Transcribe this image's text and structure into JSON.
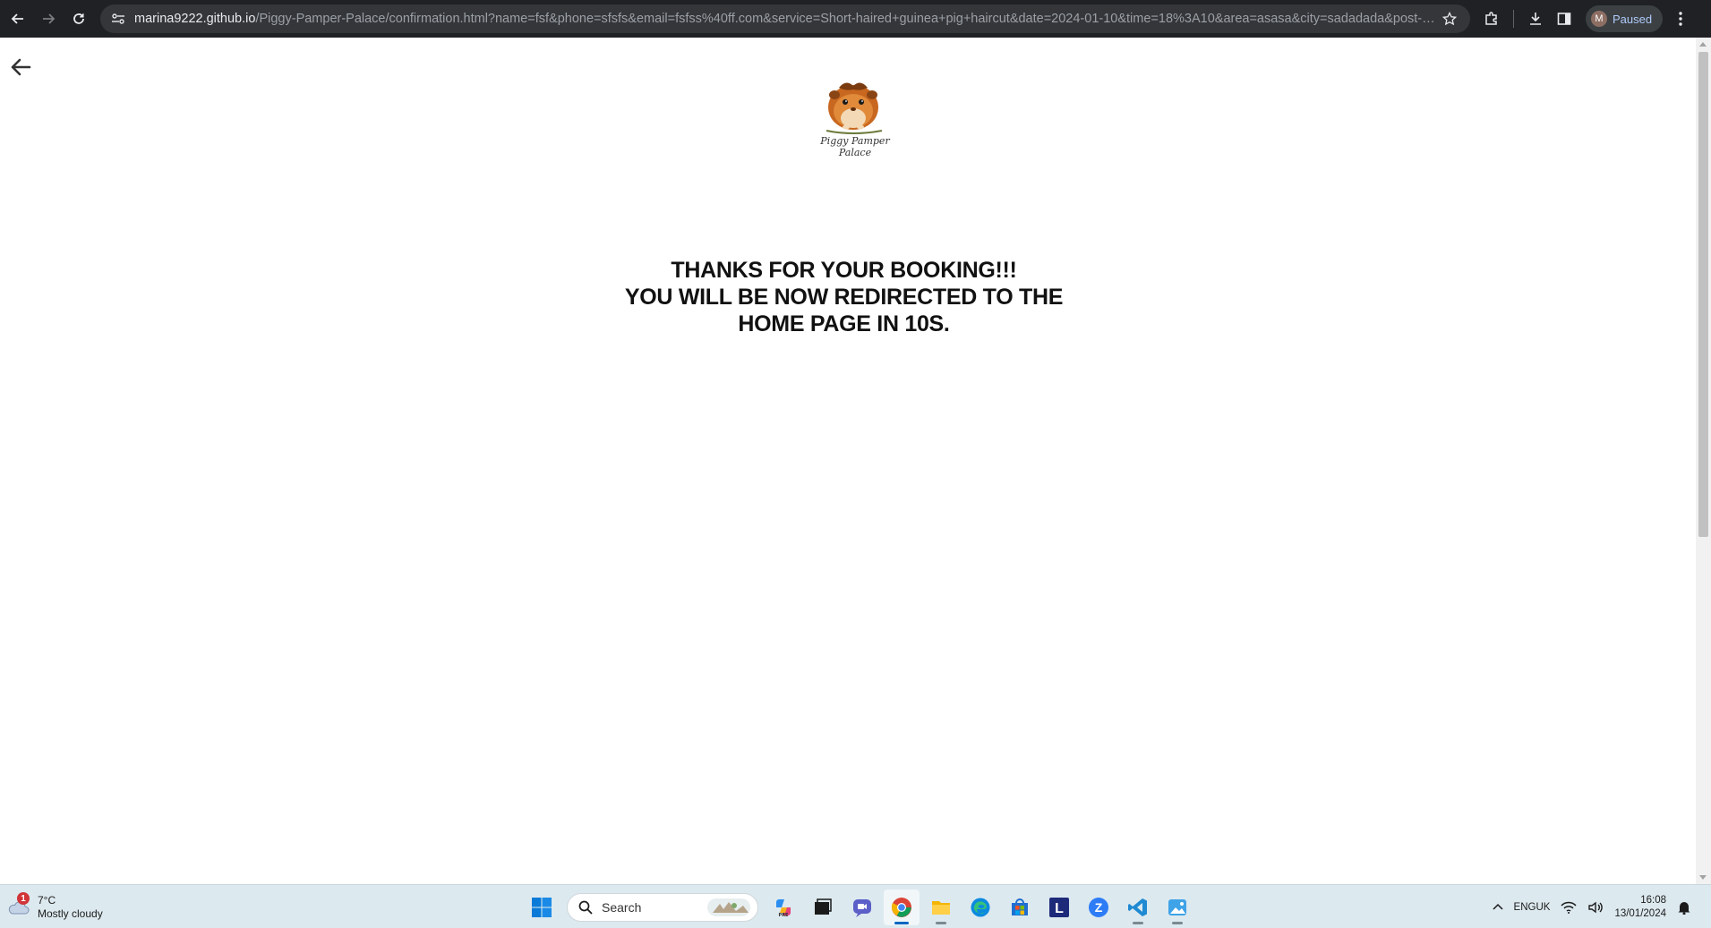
{
  "browser": {
    "url_host": "marina9222.github.io",
    "url_path": "/Piggy-Pamper-Palace/confirmation.html?name=fsf&phone=sfsfs&email=fsfss%40ff.com&service=Short-haired+guinea+pig+haircut&date=2024-01-10&time=18%3A10&area=asasa&city=sadadada&post-code...",
    "profile_initial": "M",
    "profile_status": "Paused"
  },
  "page": {
    "logo_text_line1": "Piggy Pamper",
    "logo_text_line2": "Palace",
    "message_line1": "THANKS FOR YOUR BOOKING!!!",
    "message_line2": "YOU WILL BE NOW REDIRECTED TO THE",
    "message_line3": "HOME PAGE IN 10S."
  },
  "taskbar": {
    "weather_badge": "1",
    "weather_temp": "7°C",
    "weather_desc": "Mostly cloudy",
    "search_label": "Search",
    "lang_line1": "ENG",
    "lang_line2": "UK",
    "time": "16:08",
    "date": "13/01/2024",
    "apps": [
      "start-icon",
      "search-box",
      "copilot-icon",
      "task-view-icon",
      "teams-icon",
      "chrome-icon",
      "file-explorer-icon",
      "edge-icon",
      "microsoft-store-icon",
      "l-app-icon",
      "z-app-icon",
      "vscode-icon",
      "photos-icon"
    ]
  },
  "colors": {
    "chrome_bg": "#202124",
    "omnibox_bg": "#35363a",
    "taskbar_bg": "#dce9ef",
    "accent": "#0067c0"
  }
}
